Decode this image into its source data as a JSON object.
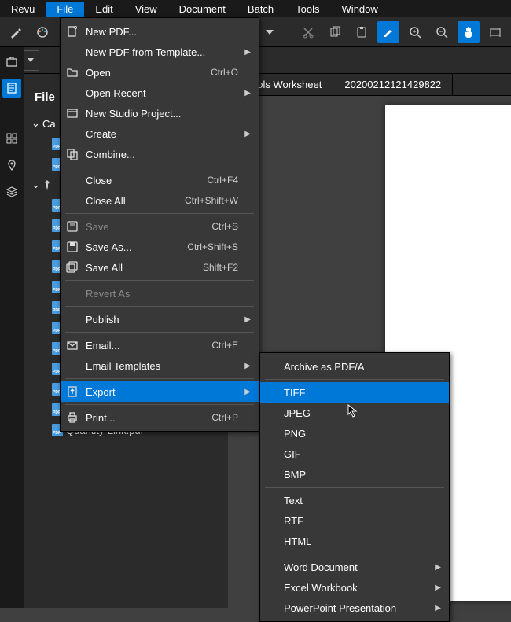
{
  "menubar": [
    "Revu",
    "File",
    "Edit",
    "View",
    "Document",
    "Batch",
    "Tools",
    "Window"
  ],
  "menubar_active_index": 1,
  "tabs": [
    {
      "label": "ools Worksheet",
      "pinned": true
    },
    {
      "label": "20200212121429822",
      "pinned": false
    }
  ],
  "panel_title": "File",
  "tree": {
    "group0": "Ca",
    "items": [
      "",
      "",
      "",
      "",
      "",
      "",
      "",
      "",
      "",
      "",
      "",
      "",
      "",
      "Quantity-Link.pdf"
    ]
  },
  "file_menu": [
    {
      "label": "New PDF...",
      "icon": "new-pdf"
    },
    {
      "label": "New PDF from Template...",
      "icon": "",
      "arrow": true
    },
    {
      "label": "Open",
      "icon": "folder",
      "shortcut": "Ctrl+O"
    },
    {
      "label": "Open Recent",
      "icon": "",
      "arrow": true
    },
    {
      "label": "New Studio Project...",
      "icon": "project"
    },
    {
      "label": "Create",
      "icon": "",
      "arrow": true
    },
    {
      "label": "Combine...",
      "icon": "combine"
    },
    {
      "sep": true
    },
    {
      "label": "Close",
      "shortcut": "Ctrl+F4"
    },
    {
      "label": "Close All",
      "shortcut": "Ctrl+Shift+W"
    },
    {
      "sep": true
    },
    {
      "label": "Save",
      "icon": "save",
      "shortcut": "Ctrl+S",
      "disabled": true
    },
    {
      "label": "Save As...",
      "icon": "saveas",
      "shortcut": "Ctrl+Shift+S"
    },
    {
      "label": "Save All",
      "icon": "saveall",
      "shortcut": "Shift+F2"
    },
    {
      "sep": true
    },
    {
      "label": "Revert As",
      "disabled": true
    },
    {
      "sep": true
    },
    {
      "label": "Publish",
      "arrow": true
    },
    {
      "sep": true
    },
    {
      "label": "Email...",
      "icon": "email",
      "shortcut": "Ctrl+E"
    },
    {
      "label": "Email Templates",
      "arrow": true
    },
    {
      "sep": true
    },
    {
      "label": "Export",
      "icon": "export",
      "arrow": true,
      "hover": true
    },
    {
      "sep": true
    },
    {
      "label": "Print...",
      "icon": "print",
      "shortcut": "Ctrl+P"
    }
  ],
  "export_menu": [
    {
      "label": "Archive as PDF/A"
    },
    {
      "sep": true
    },
    {
      "label": "TIFF",
      "hover": true
    },
    {
      "label": "JPEG"
    },
    {
      "label": "PNG"
    },
    {
      "label": "GIF"
    },
    {
      "label": "BMP"
    },
    {
      "sep": true
    },
    {
      "label": "Text"
    },
    {
      "label": "RTF"
    },
    {
      "label": "HTML"
    },
    {
      "sep": true
    },
    {
      "label": "Word Document",
      "arrow": true
    },
    {
      "label": "Excel Workbook",
      "arrow": true
    },
    {
      "label": "PowerPoint Presentation",
      "arrow": true
    }
  ]
}
